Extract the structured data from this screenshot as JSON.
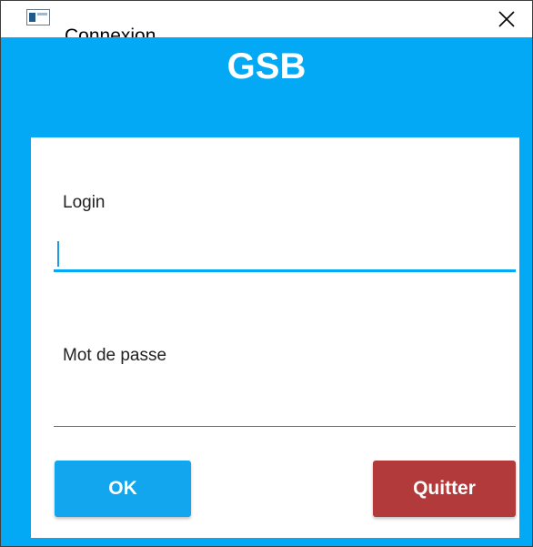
{
  "window": {
    "title": "Connexion",
    "icon": "window-app-icon",
    "close_icon": "close-icon"
  },
  "header": {
    "title": "GSB"
  },
  "form": {
    "login": {
      "label": "Login",
      "value": "",
      "placeholder": ""
    },
    "password": {
      "label": "Mot de passe",
      "value": "",
      "placeholder": ""
    }
  },
  "buttons": {
    "ok_label": "OK",
    "quit_label": "Quitter"
  },
  "colors": {
    "accent": "#03a9f4",
    "ok_button": "#12a6ee",
    "quit_button": "#b23a3a"
  }
}
